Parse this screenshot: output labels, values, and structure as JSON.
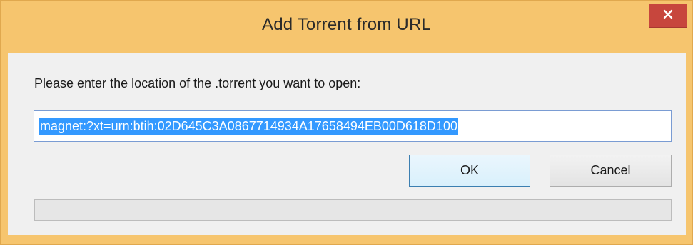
{
  "window": {
    "title": "Add Torrent from URL",
    "close_glyph": "×",
    "accent_color": "#f6c56e",
    "close_color": "#c7463d"
  },
  "dialog": {
    "prompt": "Please enter the location of the .torrent you want to open:",
    "url_value": "magnet:?xt=urn:btih:02D645C3A0867714934A17658494EB00D618D100",
    "url_selected": true,
    "ok_label": "OK",
    "cancel_label": "Cancel",
    "progress_fraction": 0
  }
}
